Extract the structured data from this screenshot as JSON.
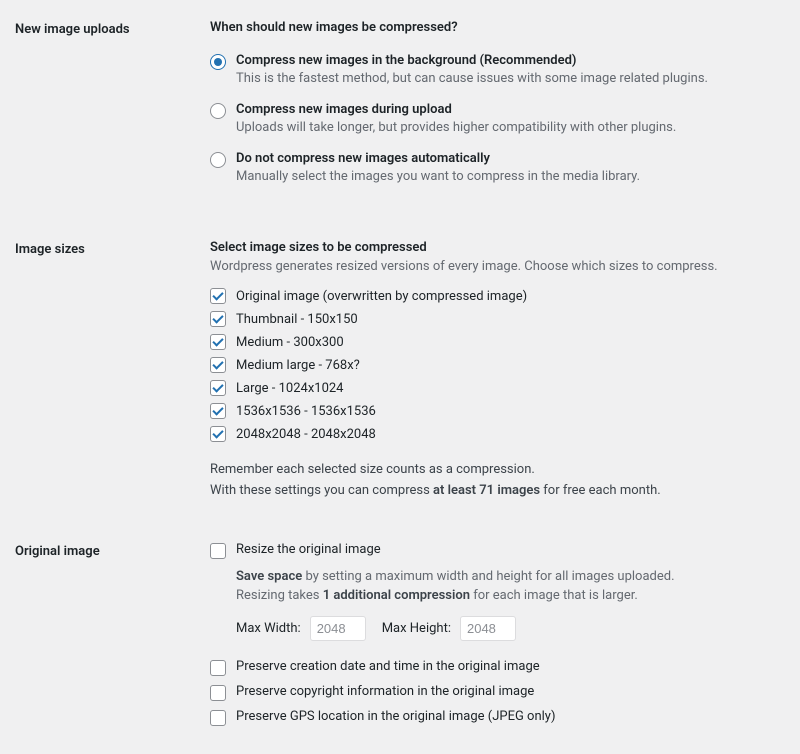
{
  "uploads": {
    "section_label": "New image uploads",
    "heading": "When should new images be compressed?",
    "options": [
      {
        "title": "Compress new images in the background (Recommended)",
        "desc": "This is the fastest method, but can cause issues with some image related plugins.",
        "checked": true
      },
      {
        "title": "Compress new images during upload",
        "desc": "Uploads will take longer, but provides higher compatibility with other plugins.",
        "checked": false
      },
      {
        "title": "Do not compress new images automatically",
        "desc": "Manually select the images you want to compress in the media library.",
        "checked": false
      }
    ]
  },
  "sizes": {
    "section_label": "Image sizes",
    "heading": "Select image sizes to be compressed",
    "sub": "Wordpress generates resized versions of every image. Choose which sizes to compress.",
    "items": [
      {
        "label": "Original image (overwritten by compressed image)",
        "checked": true
      },
      {
        "label": "Thumbnail - 150x150",
        "checked": true
      },
      {
        "label": "Medium - 300x300",
        "checked": true
      },
      {
        "label": "Medium large - 768x?",
        "checked": true
      },
      {
        "label": "Large - 1024x1024",
        "checked": true
      },
      {
        "label": "1536x1536 - 1536x1536",
        "checked": true
      },
      {
        "label": "2048x2048 - 2048x2048",
        "checked": true
      }
    ],
    "reminder_line1": "Remember each selected size counts as a compression.",
    "reminder_prefix": "With these settings you can compress ",
    "reminder_bold": "at least 71 images",
    "reminder_suffix": " for free each month."
  },
  "original": {
    "section_label": "Original image",
    "resize_label": "Resize the original image",
    "resize_checked": false,
    "desc_bold1": "Save space",
    "desc_part1": " by setting a maximum width and height for all images uploaded.",
    "desc_part2_prefix": "Resizing takes ",
    "desc_bold2": "1 additional compression",
    "desc_part2_suffix": " for each image that is larger.",
    "max_width_label": "Max Width:",
    "max_width_placeholder": "2048",
    "max_height_label": "Max Height:",
    "max_height_placeholder": "2048",
    "preserve": [
      {
        "label": "Preserve creation date and time in the original image",
        "checked": false
      },
      {
        "label": "Preserve copyright information in the original image",
        "checked": false
      },
      {
        "label": "Preserve GPS location in the original image (JPEG only)",
        "checked": false
      }
    ]
  }
}
